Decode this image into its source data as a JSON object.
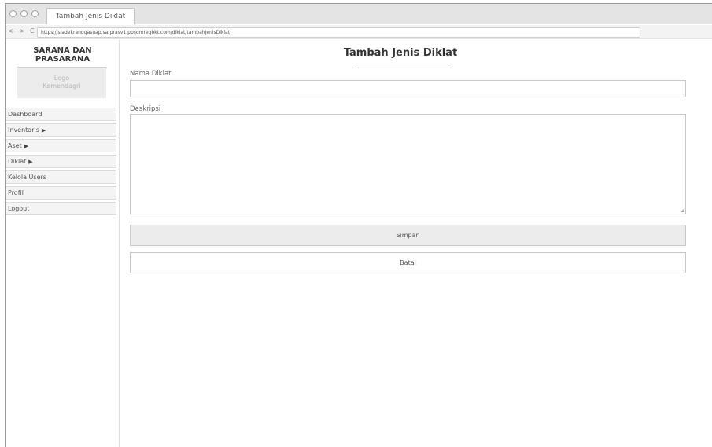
{
  "browser": {
    "tab_title": "Tambah Jenis Diklat",
    "nav_back": "<-",
    "nav_forward": "->",
    "nav_reload": "C",
    "url": "https://siadekranggasuap.sarprasv1.ppsdmregbkt.com/diklat/tambahJenisDiklat"
  },
  "sidebar": {
    "app_title_line1": "SARANA DAN",
    "app_title_line2": "PRASARANA",
    "logo_line1": "Logo",
    "logo_line2": "Kemendagri",
    "items": [
      {
        "label": "Dashboard",
        "has_arrow": false
      },
      {
        "label": "Inventaris",
        "has_arrow": true
      },
      {
        "label": "Aset",
        "has_arrow": true
      },
      {
        "label": "Diklat",
        "has_arrow": true
      },
      {
        "label": "Kelola Users",
        "has_arrow": false
      },
      {
        "label": "Profil",
        "has_arrow": false
      },
      {
        "label": "Logout",
        "has_arrow": false
      }
    ],
    "arrow_glyph": "▶"
  },
  "main": {
    "page_title": "Tambah Jenis Diklat",
    "nama_label": "Nama Diklat",
    "nama_value": "",
    "deskripsi_label": "Deskripsi",
    "deskripsi_value": "",
    "simpan_label": "Simpan",
    "batal_label": "Batal"
  }
}
